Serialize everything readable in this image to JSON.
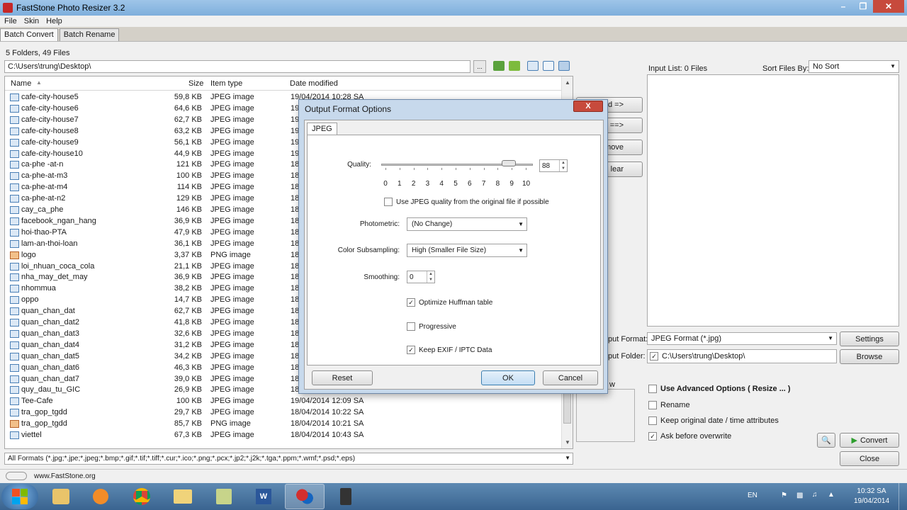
{
  "window": {
    "title": "FastStone Photo Resizer 3.2"
  },
  "menu": [
    "File",
    "Skin",
    "Help"
  ],
  "tabs": [
    "Batch Convert",
    "Batch Rename"
  ],
  "browser": {
    "folder_count": "5 Folders, 49 Files",
    "path": "C:\\Users\\trung\\Desktop\\",
    "columns": {
      "name": "Name",
      "size": "Size",
      "type": "Item type",
      "date": "Date modified"
    },
    "files": [
      {
        "name": "cafe-city-house5",
        "size": "59,8 KB",
        "type": "JPEG image",
        "date": "19/04/2014 10:28 SA",
        "kind": "jpg"
      },
      {
        "name": "cafe-city-house6",
        "size": "64,6 KB",
        "type": "JPEG image",
        "date": "19",
        "kind": "jpg"
      },
      {
        "name": "cafe-city-house7",
        "size": "62,7 KB",
        "type": "JPEG image",
        "date": "19",
        "kind": "jpg"
      },
      {
        "name": "cafe-city-house8",
        "size": "63,2 KB",
        "type": "JPEG image",
        "date": "19",
        "kind": "jpg"
      },
      {
        "name": "cafe-city-house9",
        "size": "56,1 KB",
        "type": "JPEG image",
        "date": "19",
        "kind": "jpg"
      },
      {
        "name": "cafe-city-house10",
        "size": "44,9 KB",
        "type": "JPEG image",
        "date": "19",
        "kind": "jpg"
      },
      {
        "name": "ca-phe -at-n",
        "size": "121 KB",
        "type": "JPEG image",
        "date": "18",
        "kind": "jpg"
      },
      {
        "name": "ca-phe-at-m3",
        "size": "100 KB",
        "type": "JPEG image",
        "date": "18",
        "kind": "jpg"
      },
      {
        "name": "ca-phe-at-m4",
        "size": "114 KB",
        "type": "JPEG image",
        "date": "18",
        "kind": "jpg"
      },
      {
        "name": "ca-phe-at-n2",
        "size": "129 KB",
        "type": "JPEG image",
        "date": "18",
        "kind": "jpg"
      },
      {
        "name": "cay_ca_phe",
        "size": "146 KB",
        "type": "JPEG image",
        "date": "18",
        "kind": "jpg"
      },
      {
        "name": "facebook_ngan_hang",
        "size": "36,9 KB",
        "type": "JPEG image",
        "date": "18",
        "kind": "jpg"
      },
      {
        "name": "hoi-thao-PTA",
        "size": "47,9 KB",
        "type": "JPEG image",
        "date": "18",
        "kind": "jpg"
      },
      {
        "name": "lam-an-thoi-loan",
        "size": "36,1 KB",
        "type": "JPEG image",
        "date": "18",
        "kind": "jpg"
      },
      {
        "name": "logo",
        "size": "3,37 KB",
        "type": "PNG image",
        "date": "18",
        "kind": "png"
      },
      {
        "name": "loi_nhuan_coca_cola",
        "size": "21,1 KB",
        "type": "JPEG image",
        "date": "18",
        "kind": "jpg"
      },
      {
        "name": "nha_may_det_may",
        "size": "36,9 KB",
        "type": "JPEG image",
        "date": "18",
        "kind": "jpg"
      },
      {
        "name": "nhommua",
        "size": "38,2 KB",
        "type": "JPEG image",
        "date": "18",
        "kind": "jpg"
      },
      {
        "name": "oppo",
        "size": "14,7 KB",
        "type": "JPEG image",
        "date": "18",
        "kind": "jpg"
      },
      {
        "name": "quan_chan_dat",
        "size": "62,7 KB",
        "type": "JPEG image",
        "date": "18",
        "kind": "jpg"
      },
      {
        "name": "quan_chan_dat2",
        "size": "41,8 KB",
        "type": "JPEG image",
        "date": "18",
        "kind": "jpg"
      },
      {
        "name": "quan_chan_dat3",
        "size": "32,6 KB",
        "type": "JPEG image",
        "date": "18",
        "kind": "jpg"
      },
      {
        "name": "quan_chan_dat4",
        "size": "31,2 KB",
        "type": "JPEG image",
        "date": "18",
        "kind": "jpg"
      },
      {
        "name": "quan_chan_dat5",
        "size": "34,2 KB",
        "type": "JPEG image",
        "date": "18",
        "kind": "jpg"
      },
      {
        "name": "quan_chan_dat6",
        "size": "46,3 KB",
        "type": "JPEG image",
        "date": "18",
        "kind": "jpg"
      },
      {
        "name": "quan_chan_dat7",
        "size": "39,0 KB",
        "type": "JPEG image",
        "date": "18",
        "kind": "jpg"
      },
      {
        "name": "quy_dau_tu_GIC",
        "size": "26,9 KB",
        "type": "JPEG image",
        "date": "18",
        "kind": "jpg"
      },
      {
        "name": "Tee-Cafe",
        "size": "100 KB",
        "type": "JPEG image",
        "date": "19/04/2014 12:09 SA",
        "kind": "jpg"
      },
      {
        "name": "tra_gop_tgdd",
        "size": "29,7 KB",
        "type": "JPEG image",
        "date": "18/04/2014 10:22 SA",
        "kind": "jpg"
      },
      {
        "name": "tra_gop_tgdd",
        "size": "85,7 KB",
        "type": "PNG image",
        "date": "18/04/2014 10:21 SA",
        "kind": "png"
      },
      {
        "name": "viettel",
        "size": "67,3 KB",
        "type": "JPEG image",
        "date": "18/04/2014 10:43 SA",
        "kind": "jpg"
      }
    ],
    "format_filter": "All Formats (*.jpg;*.jpe;*.jpeg;*.bmp;*.gif;*.tif;*.tiff;*.cur;*.ico;*.png;*.pcx;*.jp2;*.j2k;*.tga;*.ppm;*.wmf;*.psd;*.eps)"
  },
  "right": {
    "input_list_label": "Input List:  0 Files",
    "sort_label": "Sort Files By:",
    "sort_value": "No Sort",
    "add_btn": "d =>",
    "add_all_btn": "All ==>",
    "remove_btn": "move",
    "clear_btn": "lear",
    "output_format_label": "put Format:",
    "output_format_value": "JPEG Format (*.jpg)",
    "settings_btn": "Settings",
    "output_folder_label": "put Folder:",
    "output_folder_value": "C:\\Users\\trung\\Desktop\\",
    "browse_btn": "Browse",
    "preview_label": "w",
    "use_advanced": "Use Advanced Options ( Resize ... )",
    "rename": "Rename",
    "keep_date": "Keep original date / time attributes",
    "ask_overwrite": "Ask before overwrite",
    "convert_btn": "Convert",
    "close_btn": "Close"
  },
  "dialog": {
    "title": "Output Format Options",
    "close": "X",
    "tab": "JPEG",
    "quality_label": "Quality:",
    "quality_value": "88",
    "quality_level": 8.8,
    "tick_labels": [
      "0",
      "1",
      "2",
      "3",
      "4",
      "5",
      "6",
      "7",
      "8",
      "9",
      "10"
    ],
    "use_original_quality": "Use JPEG quality from the original file if possible",
    "photometric_label": "Photometric:",
    "photometric_value": "(No Change)",
    "subsampling_label": "Color Subsampling:",
    "subsampling_value": "High (Smaller File Size)",
    "smoothing_label": "Smoothing:",
    "smoothing_value": "0",
    "optimize_huffman": "Optimize Huffman table",
    "progressive": "Progressive",
    "keep_exif": "Keep EXIF / IPTC Data",
    "reset_btn": "Reset",
    "ok_btn": "OK",
    "cancel_btn": "Cancel"
  },
  "status": {
    "website": "www.FastStone.org"
  },
  "taskbar": {
    "lang": "EN",
    "time": "10:32 SA",
    "date": "19/04/2014"
  }
}
